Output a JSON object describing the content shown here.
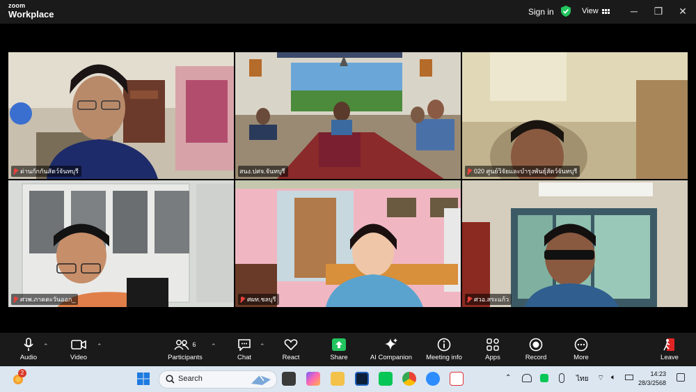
{
  "app": {
    "brand_top": "zoom",
    "brand_bottom": "Workplace"
  },
  "titlebar": {
    "signin": "Sign in",
    "view": "View",
    "shield_color": "#22c55e"
  },
  "participants": [
    {
      "name": "ด่านกักกันสัตว์จันทบุรี",
      "muted": true
    },
    {
      "name": "สนง.ปศจ.จันทบุรี",
      "muted": false,
      "active": true
    },
    {
      "name": "020 ศูนย์วิจัยและบำรุงพันธุ์สัตว์จันทบุรี",
      "muted": true
    },
    {
      "name": "ศวพ.ภาคตะวันออก_",
      "muted": true
    },
    {
      "name": "ศผท.ชลบุรี",
      "muted": true
    },
    {
      "name": "ศวอ.สระแก้ว",
      "muted": true
    }
  ],
  "toolbar": {
    "audio": "Audio",
    "video": "Video",
    "participants": "Participants",
    "participants_count": "6",
    "chat": "Chat",
    "react": "React",
    "share": "Share",
    "ai": "AI Companion",
    "meeting_info": "Meeting info",
    "apps": "Apps",
    "record": "Record",
    "more": "More",
    "leave": "Leave"
  },
  "taskbar": {
    "search_placeholder": "Search",
    "notif_count": "2",
    "time": "14:23",
    "date": "28/3/2568",
    "lang": "ไทย"
  },
  "colors": {
    "share_green": "#22c55e",
    "leave_red": "#e02424",
    "active_border": "#2fd07a"
  }
}
